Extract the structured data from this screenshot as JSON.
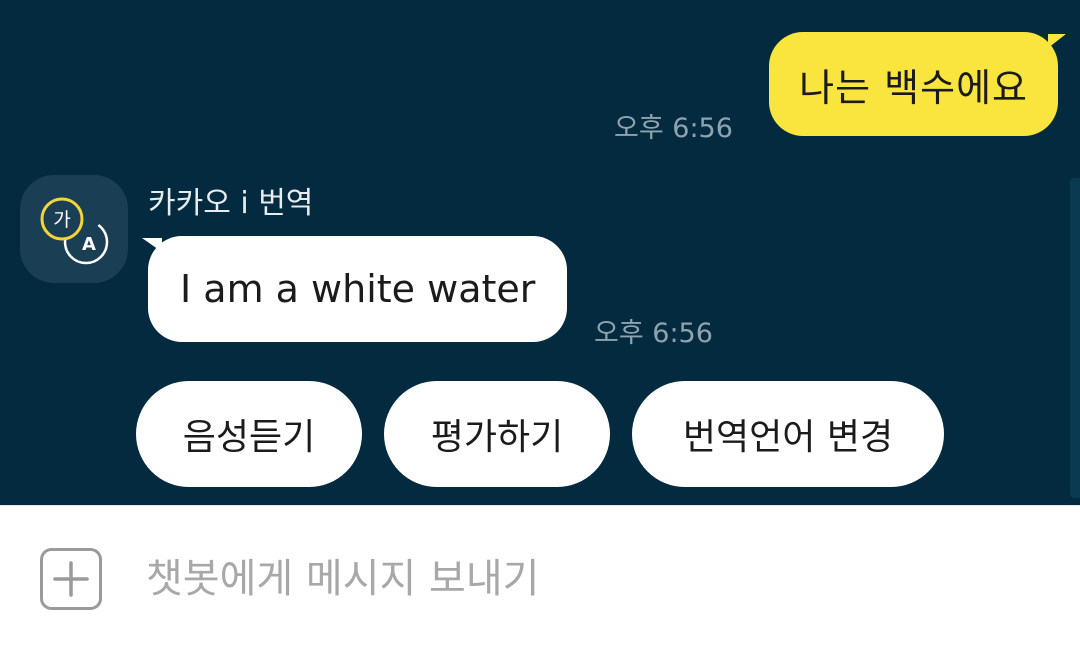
{
  "colors": {
    "chat_background": "#032a3f",
    "outgoing_bubble": "#fae53f",
    "incoming_bubble": "#ffffff",
    "timestamp": "#8fa3ae"
  },
  "outgoing_message": {
    "text": "나는 백수에요",
    "time": "오후 6:56"
  },
  "bot": {
    "name": "카카오 i 번역",
    "avatar_icon": "translate-icon",
    "avatar_glyph_top": "가",
    "avatar_glyph_bottom": "A"
  },
  "incoming_message": {
    "text": "I am a white water",
    "time": "오후 6:56"
  },
  "quick_replies": [
    {
      "label": "음성듣기"
    },
    {
      "label": "평가하기"
    },
    {
      "label": "번역언어 변경"
    }
  ],
  "input": {
    "placeholder": "챗봇에게 메시지 보내기",
    "value": "",
    "plus_icon": "plus-icon"
  }
}
